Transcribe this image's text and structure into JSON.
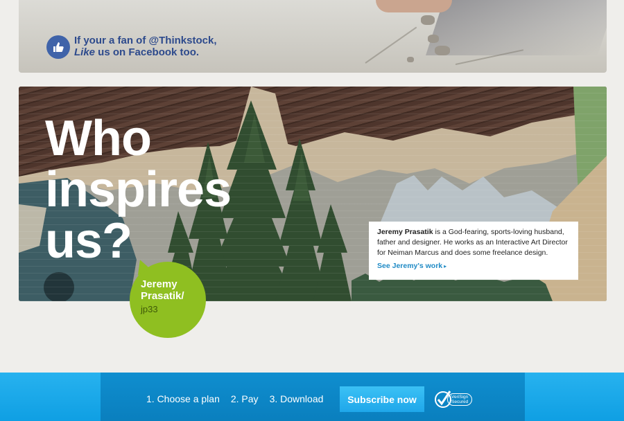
{
  "facebook_banner": {
    "line1": "If your a fan of @Thinkstock,",
    "line2_italic": "Like",
    "line2_rest": " us on Facebook too.",
    "icon": "thumbs-up-icon"
  },
  "hero": {
    "title_lines": [
      "Who",
      "inspires",
      "us?"
    ],
    "bubble": {
      "name_line1": "Jeremy",
      "name_line2": "Prasatik/",
      "handle": "jp33"
    },
    "card": {
      "name": "Jeremy Prasatik",
      "bio": " is a God-fearing, sports-loving husband, father and designer. He works as an Interactive Art Director for Neiman Marcus and does some freelance design.",
      "link_label": "See Jeremy's work",
      "link_arrow": "▸"
    }
  },
  "footer": {
    "steps": [
      "1. Choose a plan",
      "2. Pay",
      "3. Download"
    ],
    "subscribe_label": "Subscribe now",
    "verisign_line1": "VeriSign",
    "verisign_line2": "Secured"
  },
  "colors": {
    "facebook_blue": "#2d4a8c",
    "bubble_green": "#8fbf21",
    "link_blue": "#1f8ac5",
    "bar_blue": "#0f9fe3"
  }
}
